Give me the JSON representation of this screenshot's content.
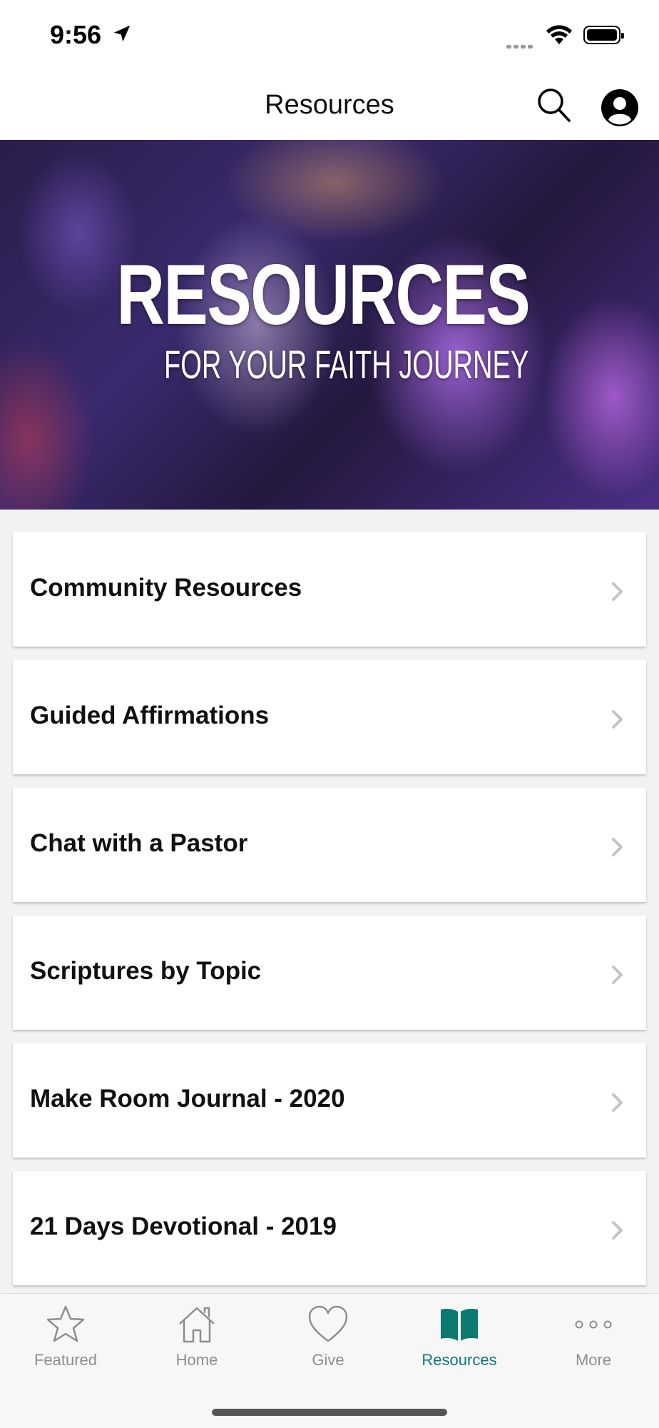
{
  "status_bar": {
    "time": "9:56"
  },
  "nav": {
    "title": "Resources"
  },
  "hero": {
    "title": "RESOURCES",
    "subtitle": "FOR YOUR FAITH JOURNEY"
  },
  "list": {
    "items": [
      {
        "label": "Community Resources"
      },
      {
        "label": "Guided Affirmations"
      },
      {
        "label": "Chat with a Pastor"
      },
      {
        "label": "Scriptures by Topic"
      },
      {
        "label": "Make Room Journal - 2020"
      },
      {
        "label": "21 Days Devotional - 2019"
      }
    ]
  },
  "tabs": [
    {
      "label": "Featured",
      "icon": "star-icon",
      "active": false
    },
    {
      "label": "Home",
      "icon": "home-icon",
      "active": false
    },
    {
      "label": "Give",
      "icon": "heart-icon",
      "active": false
    },
    {
      "label": "Resources",
      "icon": "book-icon",
      "active": true
    },
    {
      "label": "More",
      "icon": "more-dots-icon",
      "active": false
    }
  ],
  "colors": {
    "accent": "#0d7a6f",
    "inactive": "#8e8e8e"
  }
}
